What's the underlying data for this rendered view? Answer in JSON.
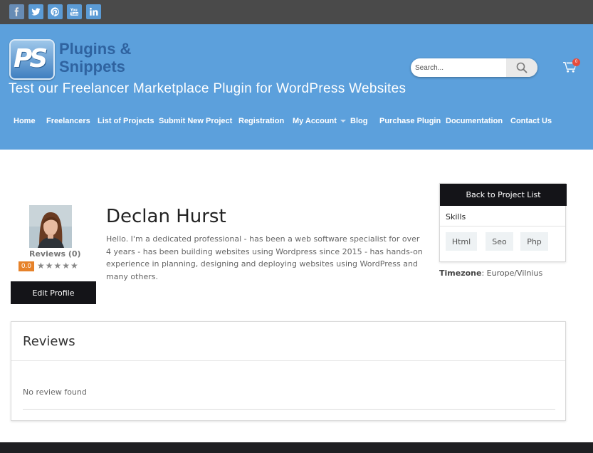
{
  "social": {
    "icons": [
      "facebook-icon",
      "twitter-icon",
      "pinterest-icon",
      "youtube-icon",
      "linkedin-icon"
    ]
  },
  "header": {
    "logo_mark": "PS",
    "logo_line1": "Plugins &",
    "logo_line2": "Snippets",
    "tagline": "Test our Freelancer Marketplace Plugin for WordPress Websites",
    "search_placeholder": "Search...",
    "cart_count": "0"
  },
  "nav": {
    "items": [
      {
        "label": "Home"
      },
      {
        "label": "Freelancers"
      },
      {
        "label": "List of Projects"
      },
      {
        "label": "Submit New Project"
      },
      {
        "label": "Registration"
      },
      {
        "label": "My Account"
      },
      {
        "label": "Blog"
      },
      {
        "label": "Purchase Plugin"
      },
      {
        "label": "Documentation"
      },
      {
        "label": "Contact Us"
      }
    ]
  },
  "profile": {
    "reviews_label": "Reviews (0)",
    "rating": "0.0",
    "stars": "★★★★★",
    "edit_label": "Edit Profile",
    "name": "Declan Hurst",
    "bio": "Hello. I'm a dedicated professional - has been a web software specialist for over 4 years - has been building websites using Wordpress since 2015 - has hands-on experience in planning, designing and deploying websites using WordPress and many others."
  },
  "sidebar": {
    "back_label": "Back to Project List",
    "skills_label": "Skills",
    "skills": [
      "Html",
      "Seo",
      "Php"
    ],
    "timezone_label": "Timezone",
    "timezone_value": ": Europe/Vilnius"
  },
  "reviews": {
    "title": "Reviews",
    "empty_text": "No review found"
  },
  "colors": {
    "header_bg": "#5ca0dc",
    "topbar_bg": "#4a4a4a",
    "button_bg": "#141418",
    "rating_badge": "#e6822a"
  }
}
